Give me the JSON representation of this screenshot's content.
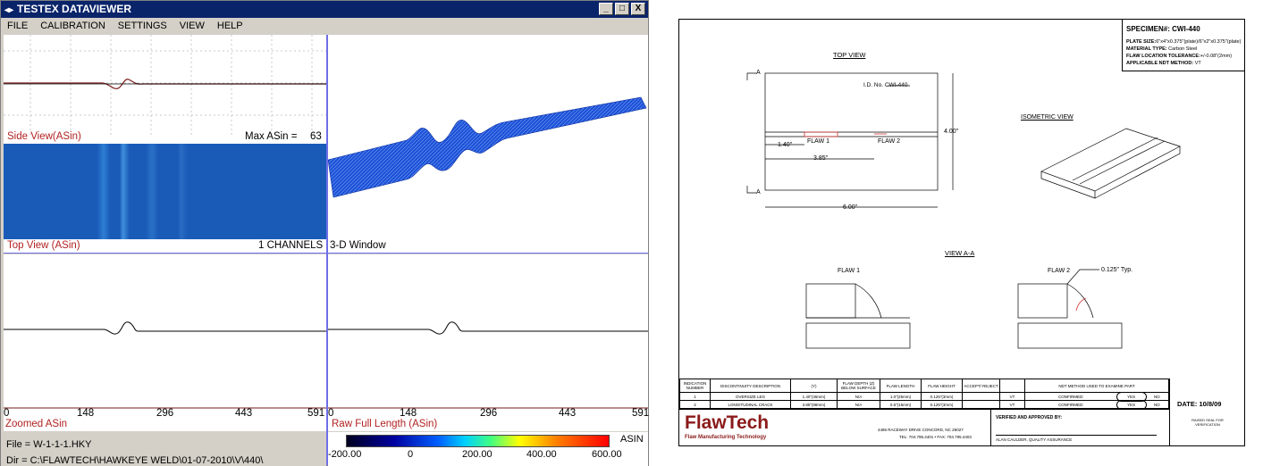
{
  "app": {
    "title": "TESTEX DATAVIEWER",
    "window_buttons": {
      "minimize": "_",
      "maximize": "□",
      "close": "X"
    },
    "menu": [
      "FILE",
      "CALIBRATION",
      "SETTINGS",
      "VIEW",
      "HELP"
    ],
    "side_view": {
      "label": "Side View(ASin)",
      "max_label": "Max ASin =",
      "max_value": "63"
    },
    "top_view": {
      "label": "Top View (ASin)",
      "channels": "1 CHANNELS"
    },
    "three_d": {
      "label": "3-D Window"
    },
    "zoomed": {
      "label": "Zoomed ASin",
      "ticks": [
        "0",
        "148",
        "296",
        "443",
        "591"
      ]
    },
    "raw": {
      "label": "Raw Full Length (ASin)",
      "ticks": [
        "0",
        "148",
        "296",
        "443",
        "591"
      ]
    },
    "status": {
      "file": "File = W-1-1-1.HKY",
      "dir": "Dir = C:\\FLAWTECH\\HAWKEYE WELD\\01-07-2010\\V\\440\\"
    },
    "colorbar": {
      "unit": "ASIN",
      "ticks": [
        "-200.00",
        "0",
        "200.00",
        "400.00",
        "600.00"
      ]
    }
  },
  "drawing": {
    "specimen": {
      "label": "SPECIMEN#:",
      "value": "CWI-440"
    },
    "plate_size": {
      "label": "PLATE SIZE:",
      "value": "6\"x4\"x0.375\"(plate)/6\"x2\"x0.375\"(plate)"
    },
    "material": {
      "label": "MATERIAL TYPE:",
      "value": "Carbon Steel"
    },
    "tolerance": {
      "label": "FLAW LOCATION TOLERANCE:",
      "value": "+/-0.08\"(2mm)"
    },
    "ndt": {
      "label": "APPLICABLE NDT METHOD:",
      "value": "VT"
    },
    "top_view_title": "TOP VIEW",
    "iso_title": "ISOMETRIC VIEW",
    "view_aa_title": "VIEW A-A",
    "section_mark": "A",
    "id_label": "I.D. No.",
    "id_value": "CWI-440",
    "flaw1": "FLAW 1",
    "flaw2": "FLAW 2",
    "dim_140": "1.40\"",
    "dim_385": "3.85\"",
    "dim_600": "6.00\"",
    "dim_400": "4.00\"",
    "dim_0125": "0.125\" Typ.",
    "table": {
      "headers": [
        "INDICATION NUMBER",
        "DISCONTINUITY DESCRIPTION",
        "(Y)",
        "FLAW DEPTH (Z) BELOW SURFACE",
        "FLAW LENGTH",
        "FLAW HEIGHT",
        "ACCEPT/ REJECT",
        "",
        "NDT METHOD USED TO EXAMINE PART"
      ],
      "rows": [
        [
          "1",
          "OVERSIZE LEG",
          "1.40\"(36mm)",
          "N/A",
          "1.0\"(25mm)",
          "0.125\"(3mm)",
          "",
          "VT",
          "CONFIRMED:",
          "YES",
          "NO"
        ],
        [
          "2",
          "LONGITUDINAL CRACK",
          "3.85\"(98mm)",
          "N/A",
          "0.6\"(15mm)",
          "0.125\"(3mm)",
          "",
          "VT",
          "CONFIRMED:",
          "YES",
          "NO"
        ]
      ]
    },
    "date_label": "DATE:",
    "date_value": "10/8/09",
    "raised_seal": "RAISED SEAL FOR VERIFICATION",
    "logo": "FlawTech",
    "logo_sub": "Flaw Manufacturing Technology",
    "address": "4486 RACEWAY DRIVE    CONCORD, NC  28027",
    "phone": "TEL: 704.795.4401  •  FAX: 704.795.4403",
    "verified": "VERIFIED AND APPROVED BY:",
    "signer": "ALAN CAULDER, QUALITY ASSURANCE"
  }
}
